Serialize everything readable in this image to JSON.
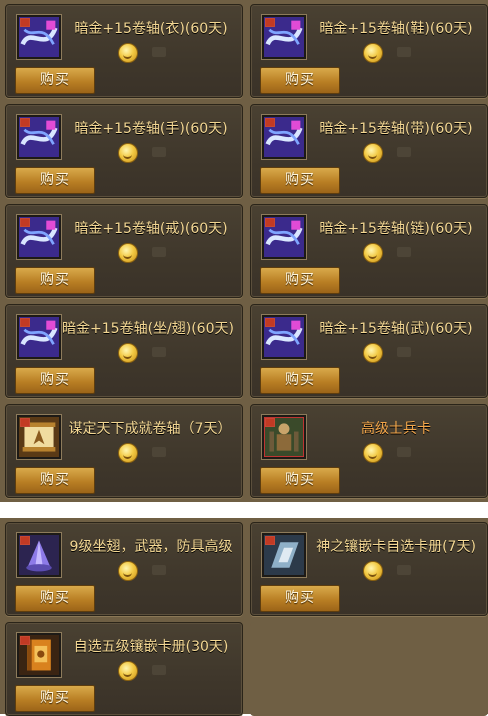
{
  "items": [
    {
      "title": "暗金+15卷轴(衣)(60天)",
      "icon": "scroll-icon",
      "buy_label": "购买"
    },
    {
      "title": "暗金+15卷轴(鞋)(60天)",
      "icon": "scroll-icon",
      "buy_label": "购买"
    },
    {
      "title": "暗金+15卷轴(手)(60天)",
      "icon": "scroll-icon",
      "buy_label": "购买"
    },
    {
      "title": "暗金+15卷轴(带)(60天)",
      "icon": "scroll-icon",
      "buy_label": "购买"
    },
    {
      "title": "暗金+15卷轴(戒)(60天)",
      "icon": "scroll-icon",
      "buy_label": "购买"
    },
    {
      "title": "暗金+15卷轴(链)(60天)",
      "icon": "scroll-icon",
      "buy_label": "购买"
    },
    {
      "title": "暗金+15卷轴(坐/翅)(60天)",
      "icon": "scroll-icon",
      "buy_label": "购买"
    },
    {
      "title": "暗金+15卷轴(武)(60天)",
      "icon": "scroll-icon",
      "buy_label": "购买"
    },
    {
      "title": "谋定天下成就卷轴（7天）",
      "icon": "parchment-scroll-icon",
      "buy_label": "购买"
    },
    {
      "title": "高级士兵卡",
      "icon": "soldier-card-icon",
      "buy_label": "购买"
    },
    {
      "title": "9级坐翅，武器，防具高级",
      "icon": "crystal-icon",
      "buy_label": "购买"
    },
    {
      "title": "神之镶嵌卡自选卡册(7天)",
      "icon": "card-album-icon",
      "buy_label": "购买"
    },
    {
      "title": "自选五级镶嵌卡册(30天)",
      "icon": "book-icon",
      "buy_label": "购买"
    }
  ],
  "colors": {
    "panel_bg": "#6f5f44",
    "card_bg": "#3f372b",
    "title_gold": "#f2d692",
    "title_orange": "#f3a64a",
    "button_gold": "#b97f24"
  }
}
